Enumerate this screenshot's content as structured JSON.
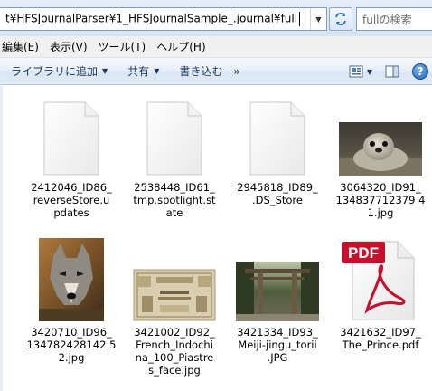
{
  "address_bar": {
    "path": "t¥HFSJournalParser¥1_HFSJournalSample_.journal¥full",
    "search_placeholder": "fullの検索"
  },
  "menu": [
    {
      "label": "(E)",
      "display": "編集(E)"
    },
    {
      "label": "表示(V)"
    },
    {
      "label": "ツール(T)"
    },
    {
      "label": "ヘルプ(H)"
    }
  ],
  "menu_labels": [
    "編集(E)",
    "表示(V)",
    "ツール(T)",
    "ヘルプ(H)"
  ],
  "command_bar": {
    "library_label": "ライブラリに追加",
    "share_label": "共有",
    "burn_label": "書き込む",
    "more_label": "»"
  },
  "files": [
    {
      "icon": "blank-document-icon",
      "lines": [
        "2412046_ID86_",
        "reverseStore.u",
        "pdates"
      ]
    },
    {
      "icon": "blank-document-icon",
      "lines": [
        "2538448_ID61_",
        "tmp.spotlight.st",
        "ate"
      ]
    },
    {
      "icon": "blank-document-icon",
      "lines": [
        "2945818_ID89_",
        ".DS_Store"
      ]
    },
    {
      "icon": "seal-photo-thumbnail",
      "lines": [
        "3064320_ID91_",
        "134837712379 4",
        "1.jpg"
      ]
    },
    {
      "icon": "wolf-photo-thumbnail",
      "lines": [
        "3420710_ID96_",
        "134782428142 5",
        "2.jpg"
      ]
    },
    {
      "icon": "banknote-photo-thumbnail",
      "lines": [
        "3421002_ID92_",
        "French_Indochi",
        "na_100_Piastre",
        "s_face.jpg"
      ]
    },
    {
      "icon": "torii-photo-thumbnail",
      "lines": [
        "3421334_ID93_",
        "Meiji-jingu_torii",
        ".JPG"
      ]
    },
    {
      "icon": "pdf-icon",
      "lines": [
        "3421632_ID97_",
        "The_Prince.pdf"
      ]
    }
  ],
  "colors": {
    "command_text": "#1e395b",
    "pdf_red": "#c8102e"
  }
}
